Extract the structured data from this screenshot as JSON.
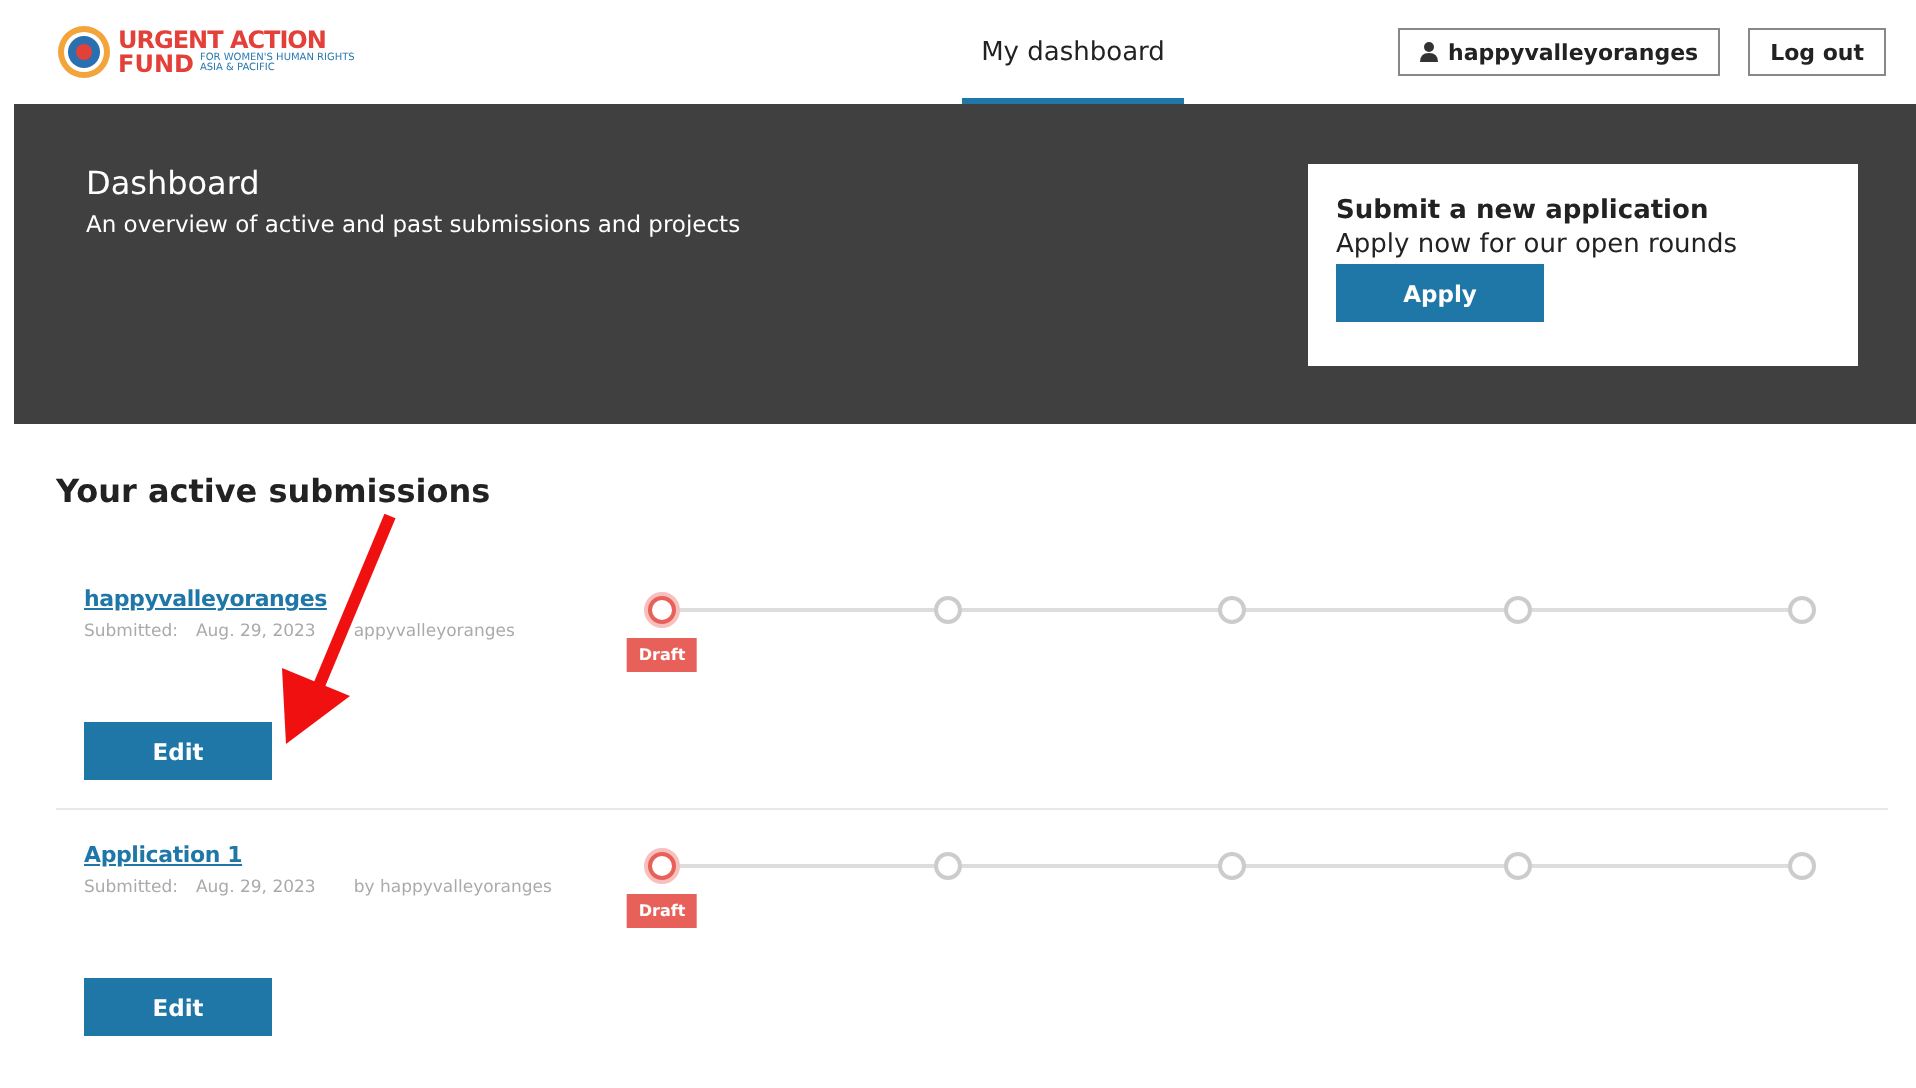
{
  "header": {
    "logo": {
      "line1": "URGENT ACTION",
      "line2": "FUND",
      "tagline1": "FOR WOMEN'S HUMAN RIGHTS",
      "tagline2": "ASIA & PACIFIC"
    },
    "nav": [
      {
        "label": "My dashboard",
        "selected": true
      }
    ],
    "user_button": "happyvalleyoranges",
    "logout_button": "Log out"
  },
  "banner": {
    "title": "Dashboard",
    "subtitle": "An overview of active and past submissions and projects",
    "card": {
      "title": "Submit a new application",
      "text": "Apply now for our open rounds",
      "button": "Apply"
    }
  },
  "section_title": "Your active submissions",
  "submissions": [
    {
      "name": "happyvalleyoranges",
      "submitted_label": "Submitted:",
      "submitted_date": "Aug. 29, 2023",
      "submitted_by": "appyvalleyoranges",
      "button": "Edit",
      "steps": [
        {
          "selected": true,
          "label": "Draft"
        },
        {
          "selected": false
        },
        {
          "selected": false
        },
        {
          "selected": false
        },
        {
          "selected": false
        }
      ]
    },
    {
      "name": "Application 1",
      "submitted_label": "Submitted:",
      "submitted_date": "Aug. 29, 2023",
      "submitted_by": "by happyvalleyoranges",
      "button": "Edit",
      "steps": [
        {
          "selected": true,
          "label": "Draft"
        },
        {
          "selected": false
        },
        {
          "selected": false
        },
        {
          "selected": false
        },
        {
          "selected": false
        }
      ]
    }
  ]
}
